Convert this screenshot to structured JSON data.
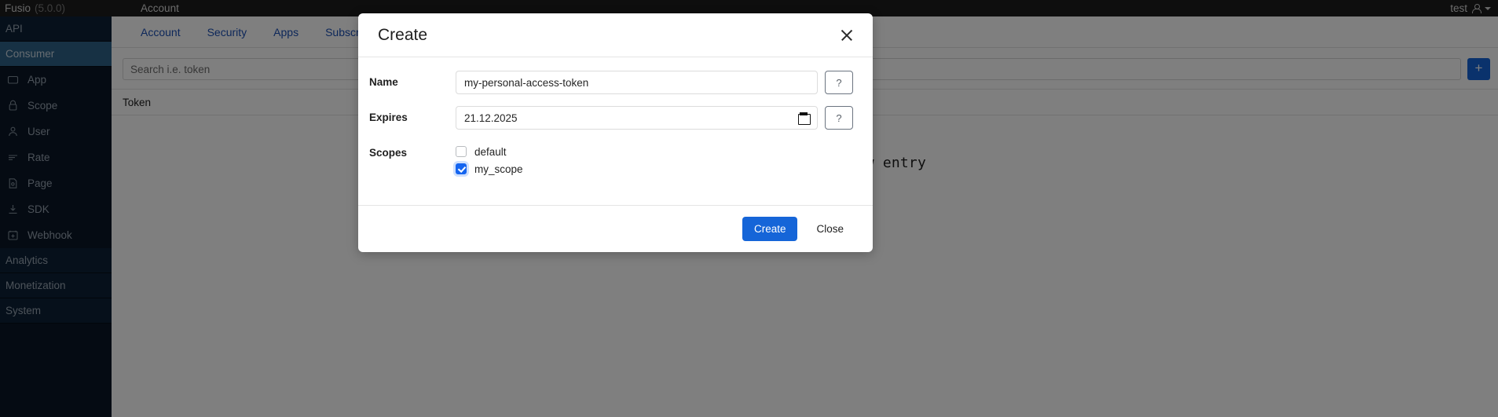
{
  "topbar": {
    "brand": "Fusio",
    "version": "(5.0.0)",
    "menu_account": "Account",
    "user": "test",
    "user_icon": "person-icon",
    "caret_icon": "chevron-down-icon"
  },
  "sidebar": {
    "sections": [
      {
        "label": "API",
        "active": false,
        "type": "header"
      },
      {
        "label": "Consumer",
        "active": true,
        "type": "header"
      }
    ],
    "items": [
      {
        "label": "App",
        "icon": "app-square-icon"
      },
      {
        "label": "Scope",
        "icon": "lock-icon"
      },
      {
        "label": "User",
        "icon": "user-icon"
      },
      {
        "label": "Rate",
        "icon": "rate-lines-icon"
      },
      {
        "label": "Page",
        "icon": "page-icon"
      },
      {
        "label": "SDK",
        "icon": "download-icon"
      },
      {
        "label": "Webhook",
        "icon": "webhook-plus-icon"
      }
    ],
    "footer_sections": [
      {
        "label": "Analytics"
      },
      {
        "label": "Monetization"
      },
      {
        "label": "System"
      }
    ]
  },
  "main": {
    "tabs": [
      {
        "label": "Account"
      },
      {
        "label": "Security"
      },
      {
        "label": "Apps"
      },
      {
        "label": "Subscription"
      }
    ],
    "search_placeholder": "Search i.e. token",
    "add_button": "+",
    "table_header": "Token",
    "empty_message": "button to create a new entry"
  },
  "modal": {
    "title": "Create",
    "close_icon": "close-icon",
    "fields": {
      "name_label": "Name",
      "name_value": "my-personal-access-token",
      "name_help": "?",
      "expires_label": "Expires",
      "expires_value": "21.12.2025",
      "expires_help": "?",
      "calendar_icon": "calendar-icon",
      "scopes_label": "Scopes"
    },
    "scopes": [
      {
        "label": "default",
        "checked": false
      },
      {
        "label": "my_scope",
        "checked": true
      }
    ],
    "buttons": {
      "create": "Create",
      "close": "Close"
    }
  },
  "colors": {
    "accent_blue": "#1565d8",
    "sidebar_bg": "#0a1626",
    "sidebar_active": "#2e6389",
    "topbar_bg": "#1c1c1c",
    "link_blue": "#1a4fb4"
  }
}
